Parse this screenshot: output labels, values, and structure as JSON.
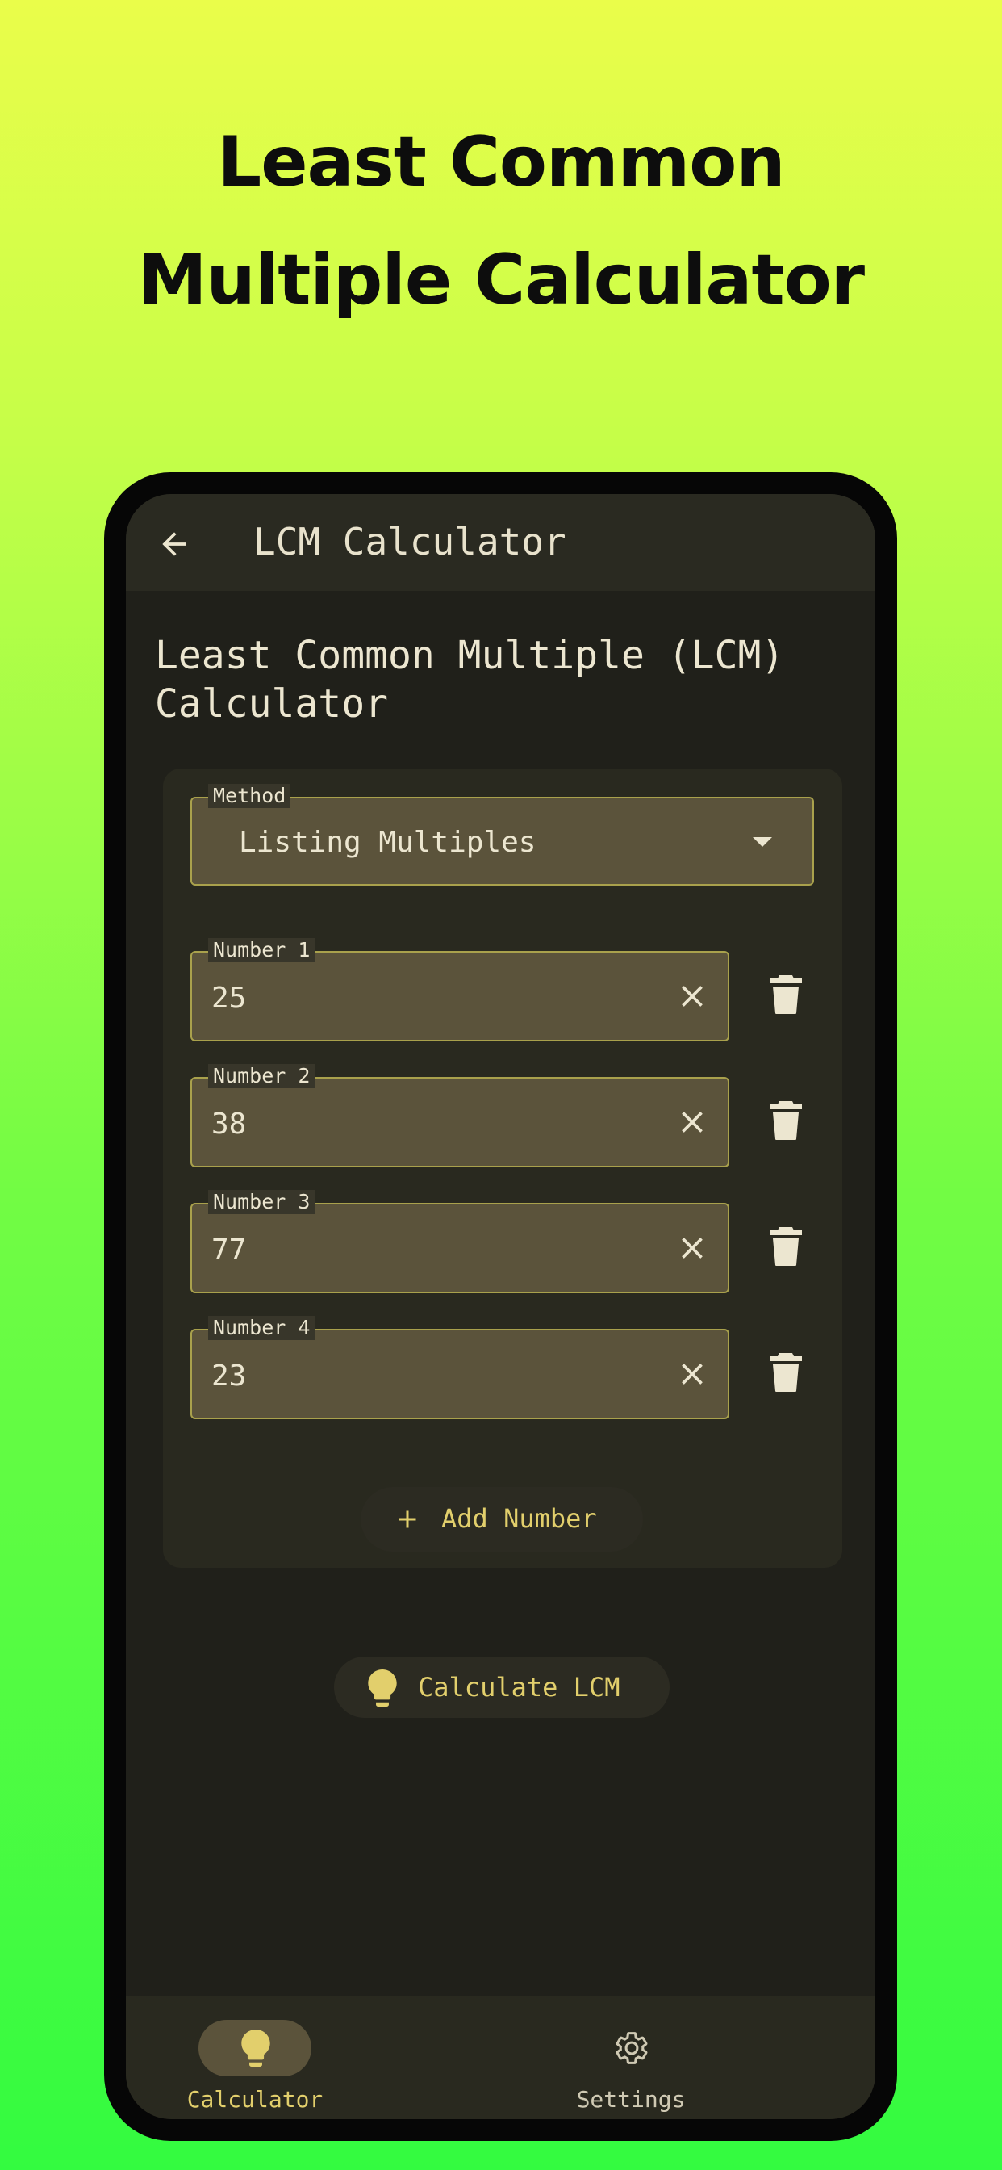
{
  "promo": {
    "line1": "Least Common",
    "line2": "Multiple Calculator"
  },
  "appbar": {
    "back_icon": "arrow-left-icon",
    "title": "LCM Calculator"
  },
  "page": {
    "title": "Least Common Multiple (LCM)\nCalculator"
  },
  "method": {
    "label": "Method",
    "value": "Listing Multiples"
  },
  "numbers": [
    {
      "label": "Number 1",
      "value": "25"
    },
    {
      "label": "Number 2",
      "value": "38"
    },
    {
      "label": "Number 3",
      "value": "77"
    },
    {
      "label": "Number 4",
      "value": "23"
    }
  ],
  "actions": {
    "add_label": "Add Number",
    "calculate_label": "Calculate LCM"
  },
  "nav": {
    "calculator_label": "Calculator",
    "settings_label": "Settings"
  },
  "colors": {
    "accent": "#e2cf6c",
    "field_bg": "#5b533b",
    "field_border": "#a9a14c",
    "screen_bg": "#20201a"
  }
}
